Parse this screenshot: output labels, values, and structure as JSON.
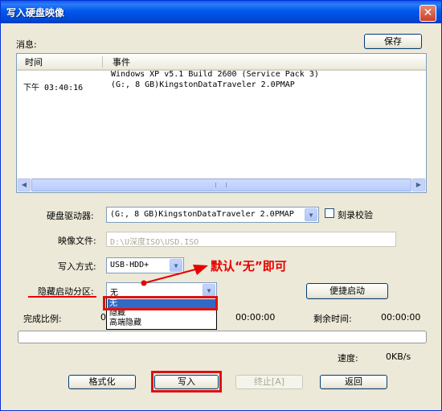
{
  "window": {
    "title": "写入硬盘映像",
    "close_glyph": "✕"
  },
  "messages": {
    "label": "消息:",
    "save_button": "保存",
    "columns": [
      "时间",
      "事件"
    ],
    "rows": [
      {
        "time": "",
        "event": "Windows XP v5.1 Build 2600 (Service Pack 3)"
      },
      {
        "time": "下午 03:40:16",
        "event": "(G:, 8 GB)KingstonDataTraveler 2.0PMAP"
      }
    ]
  },
  "drive": {
    "label": "硬盘驱动器:",
    "value": "(G:, 8 GB)KingstonDataTraveler 2.0PMAP",
    "verify_label": "刻录校验",
    "verify_checked": false
  },
  "image_file": {
    "label": "映像文件:",
    "value": "D:\\U深度ISO\\USD.ISO"
  },
  "write_mode": {
    "label": "写入方式:",
    "value": "USB-HDD+"
  },
  "hidden_partition": {
    "label": "隐藏启动分区:",
    "value": "无",
    "options": [
      "无",
      "隐藏",
      "高端隐藏"
    ],
    "selected_index": 0
  },
  "quick_boot_button": "便捷启动",
  "progress": {
    "ratio_label": "完成比例:",
    "ratio_value": "0",
    "elapsed_value": "00:00:00",
    "remaining_label": "剩余时间:",
    "remaining_value": "00:00:00",
    "speed_label": "速度:",
    "speed_value": "0KB/s",
    "fraction": 0
  },
  "buttons": {
    "format": "格式化",
    "write": "写入",
    "stop": "终止[A]",
    "back": "返回"
  },
  "annotation": {
    "text": "默认“无”即可",
    "color": "#e60000"
  }
}
